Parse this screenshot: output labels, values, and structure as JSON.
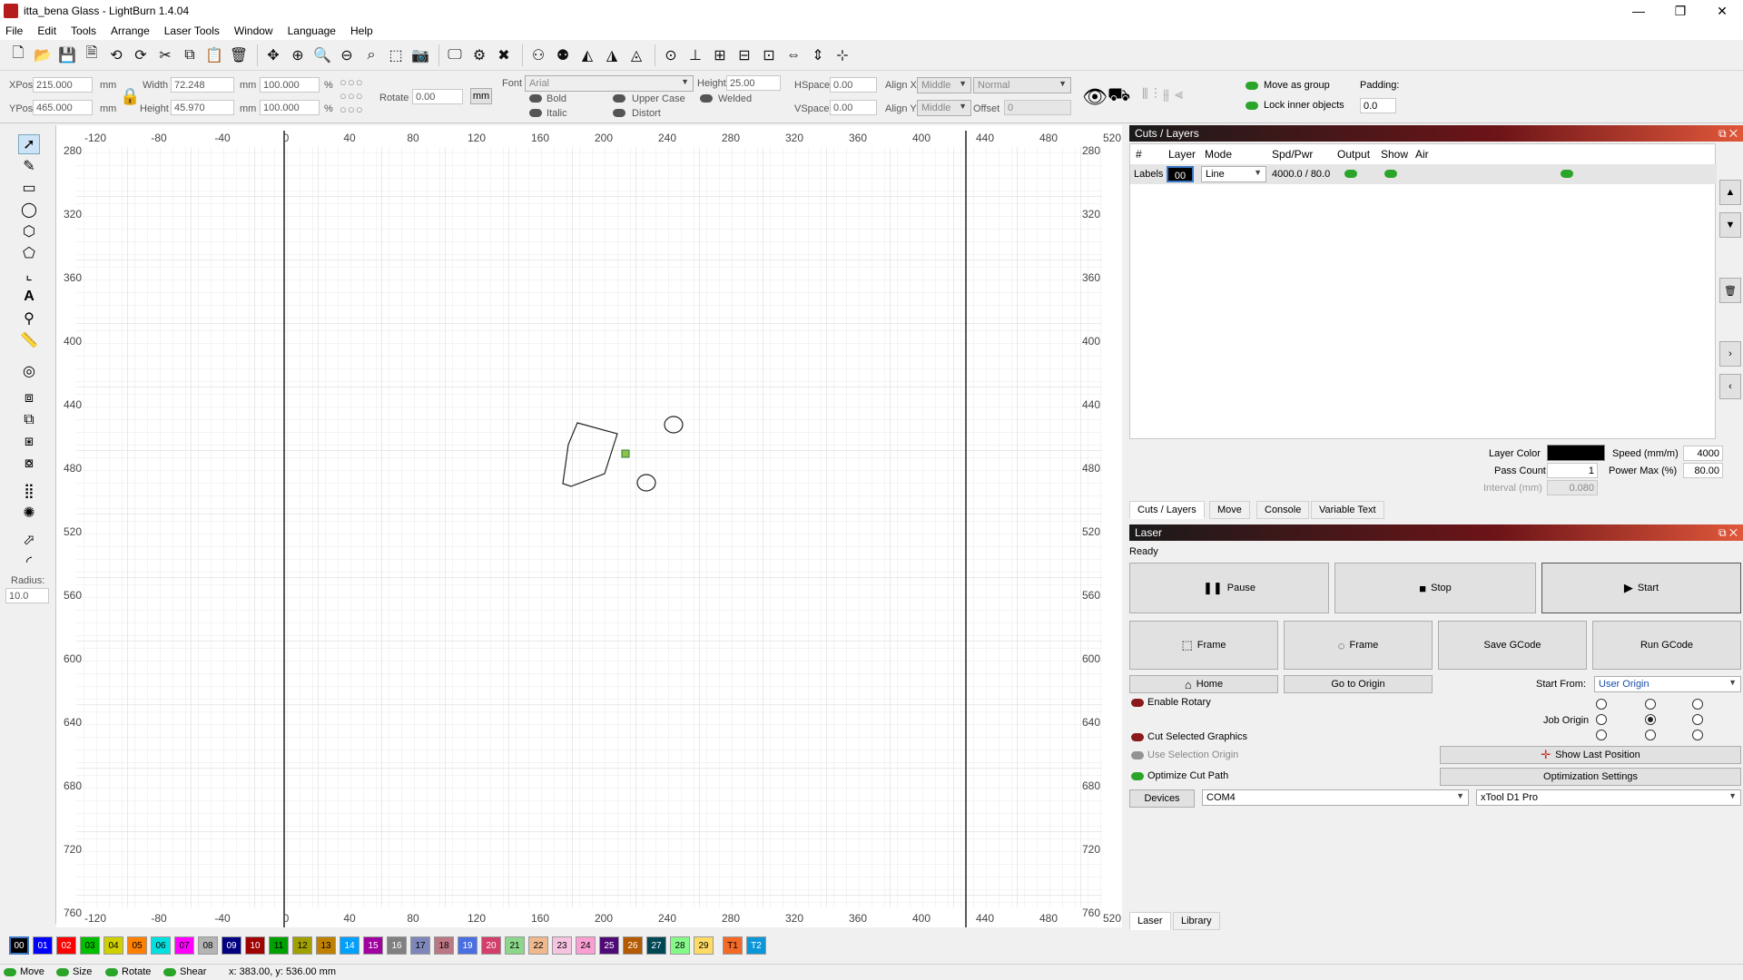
{
  "window": {
    "title": "itta_bena Glass - LightBurn 1.4.04",
    "controls": [
      "—",
      "❐",
      "✕"
    ]
  },
  "menu": [
    "File",
    "Edit",
    "Tools",
    "Arrange",
    "Laser Tools",
    "Window",
    "Language",
    "Help"
  ],
  "props": {
    "xpos_label": "XPos",
    "xpos": "215.000",
    "ypos_label": "YPos",
    "ypos": "465.000",
    "mm": "mm",
    "width_label": "Width",
    "width": "72.248",
    "height_label": "Height",
    "height": "45.970",
    "width_pct": "100.000",
    "height_pct": "100.000",
    "pct": "%",
    "rotate_label": "Rotate",
    "rotate": "0.00",
    "unit_btn": "mm",
    "font_label": "Font",
    "font": "Arial",
    "font_height_label": "Height",
    "font_height": "25.00",
    "hspace_label": "HSpace",
    "hspace": "0.00",
    "vspace_label": "VSpace",
    "vspace": "0.00",
    "alignx_label": "Align X",
    "alignx": "Middle",
    "aligny_label": "Align Y",
    "aligny": "Middle",
    "normal": "Normal",
    "offset_label": "Offset",
    "offset": "0",
    "bold": "Bold",
    "italic": "Italic",
    "upper_case": "Upper Case",
    "distort": "Distort",
    "welded": "Welded",
    "move_as_group": "Move as group",
    "lock_inner": "Lock inner objects",
    "padding_label": "Padding:",
    "padding": "0.0"
  },
  "ruler": {
    "x_ticks": [
      "-120",
      "-80",
      "-40",
      "0",
      "40",
      "80",
      "120",
      "160",
      "200",
      "240",
      "280",
      "320",
      "360",
      "400",
      "440",
      "480",
      "520"
    ],
    "y_ticks": [
      "280",
      "320",
      "360",
      "400",
      "440",
      "480",
      "520",
      "560",
      "600",
      "640",
      "680",
      "720",
      "760"
    ],
    "radius_label": "Radius:",
    "radius": "10.0"
  },
  "cuts": {
    "title": "Cuts / Layers",
    "headers": [
      "#",
      "Layer",
      "Mode",
      "Spd/Pwr",
      "Output",
      "Show",
      "Air"
    ],
    "row": {
      "name": "Labels",
      "layer": "00",
      "mode": "Line",
      "spdpwr": "4000.0 / 80.0"
    },
    "layer_color_label": "Layer Color",
    "layer_color": "#000000",
    "speed_label": "Speed (mm/m)",
    "speed": "4000",
    "pass_count_label": "Pass Count",
    "pass_count": "1",
    "power_max_label": "Power Max (%)",
    "power_max": "80.00",
    "interval_label": "Interval (mm)",
    "interval": "0.080",
    "tabs": [
      "Cuts / Layers",
      "Move",
      "Console",
      "Variable Text"
    ]
  },
  "laser": {
    "title": "Laser",
    "status": "Ready",
    "pause": "Pause",
    "stop": "Stop",
    "start": "Start",
    "frame1": "Frame",
    "frame2": "Frame",
    "save_gcode": "Save GCode",
    "run_gcode": "Run GCode",
    "home": "Home",
    "go_to_origin": "Go to Origin",
    "start_from_label": "Start From:",
    "start_from": "User Origin",
    "enable_rotary": "Enable Rotary",
    "job_origin_label": "Job Origin",
    "cut_selected": "Cut Selected Graphics",
    "use_selection_origin": "Use Selection Origin",
    "optimize_cut_path": "Optimize Cut Path",
    "show_last_position": "Show Last Position",
    "optimization_settings": "Optimization Settings",
    "devices": "Devices",
    "port": "COM4",
    "device": "xTool D1 Pro",
    "tabs": [
      "Laser",
      "Library"
    ]
  },
  "palette": [
    {
      "label": "00",
      "color": "#000000",
      "text": "#ffffff"
    },
    {
      "label": "01",
      "color": "#0000ff",
      "text": "#ffffff"
    },
    {
      "label": "02",
      "color": "#ff0000",
      "text": "#ffffff"
    },
    {
      "label": "03",
      "color": "#00c000",
      "text": "#000000"
    },
    {
      "label": "04",
      "color": "#d0d000",
      "text": "#000000"
    },
    {
      "label": "05",
      "color": "#ff8000",
      "text": "#000000"
    },
    {
      "label": "06",
      "color": "#00e0e0",
      "text": "#000000"
    },
    {
      "label": "07",
      "color": "#ff00ff",
      "text": "#000000"
    },
    {
      "label": "08",
      "color": "#b4b4b4",
      "text": "#000000"
    },
    {
      "label": "09",
      "color": "#000080",
      "text": "#ffffff"
    },
    {
      "label": "10",
      "color": "#a00000",
      "text": "#ffffff"
    },
    {
      "label": "11",
      "color": "#00a000",
      "text": "#000000"
    },
    {
      "label": "12",
      "color": "#a0a000",
      "text": "#000000"
    },
    {
      "label": "13",
      "color": "#c08000",
      "text": "#000000"
    },
    {
      "label": "14",
      "color": "#00a0ff",
      "text": "#ffffff"
    },
    {
      "label": "15",
      "color": "#a000a0",
      "text": "#ffffff"
    },
    {
      "label": "16",
      "color": "#808080",
      "text": "#ffffff"
    },
    {
      "label": "17",
      "color": "#7d87b9",
      "text": "#000000"
    },
    {
      "label": "18",
      "color": "#bb7784",
      "text": "#000000"
    },
    {
      "label": "19",
      "color": "#4a6fe3",
      "text": "#ffffff"
    },
    {
      "label": "20",
      "color": "#d33f6a",
      "text": "#ffffff"
    },
    {
      "label": "21",
      "color": "#8cd78c",
      "text": "#000000"
    },
    {
      "label": "22",
      "color": "#f0b98d",
      "text": "#000000"
    },
    {
      "label": "23",
      "color": "#f6c4e1",
      "text": "#000000"
    },
    {
      "label": "24",
      "color": "#fa9ed4",
      "text": "#000000"
    },
    {
      "label": "25",
      "color": "#500a78",
      "text": "#ffffff"
    },
    {
      "label": "26",
      "color": "#b45a00",
      "text": "#ffffff"
    },
    {
      "label": "27",
      "color": "#004754",
      "text": "#ffffff"
    },
    {
      "label": "28",
      "color": "#86fa88",
      "text": "#000000"
    },
    {
      "label": "29",
      "color": "#ffdb66",
      "text": "#000000"
    },
    {
      "label": "T1",
      "color": "#f36926",
      "text": "#000000"
    },
    {
      "label": "T2",
      "color": "#0c96d9",
      "text": "#ffffff"
    }
  ],
  "status": {
    "move": "Move",
    "size": "Size",
    "rotate": "Rotate",
    "shear": "Shear",
    "coords": "x: 383.00, y: 536.00 mm"
  }
}
